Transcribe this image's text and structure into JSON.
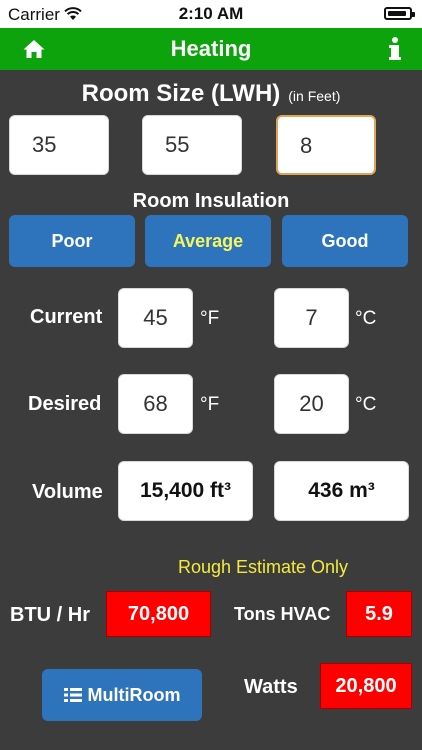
{
  "status_bar": {
    "carrier": "Carrier",
    "time": "2:10 AM"
  },
  "nav": {
    "title": "Heating",
    "home_icon": "home-icon",
    "info_icon": "info-icon",
    "bg_color": "#0da30d"
  },
  "room_size": {
    "label": "Room Size (LWH)",
    "unit_note": "(in Feet)",
    "length": "35",
    "width": "55",
    "height": "8"
  },
  "insulation": {
    "label": "Room Insulation",
    "options": [
      "Poor",
      "Average",
      "Good"
    ],
    "selected": "Average"
  },
  "current": {
    "label": "Current",
    "fahrenheit": "45",
    "celsius": "7",
    "f_unit": "°F",
    "c_unit": "°C"
  },
  "desired": {
    "label": "Desired",
    "fahrenheit": "68",
    "celsius": "20",
    "f_unit": "°F",
    "c_unit": "°C"
  },
  "volume": {
    "label": "Volume",
    "cubic_feet": "15,400 ft³",
    "cubic_meters": "436 m³"
  },
  "estimate_note": "Rough Estimate Only",
  "results": {
    "btu_label": "BTU / Hr",
    "btu_value": "70,800",
    "tons_label": "Tons HVAC",
    "tons_value": "5.9",
    "watts_label": "Watts",
    "watts_value": "20,800"
  },
  "multiroom": {
    "label": "MultiRoom",
    "icon": "list-icon"
  },
  "colors": {
    "background": "#3c3c3c",
    "accent_blue": "#2e74bd",
    "result_red": "#ff0000",
    "highlight_yellow": "#f3eb3e"
  }
}
